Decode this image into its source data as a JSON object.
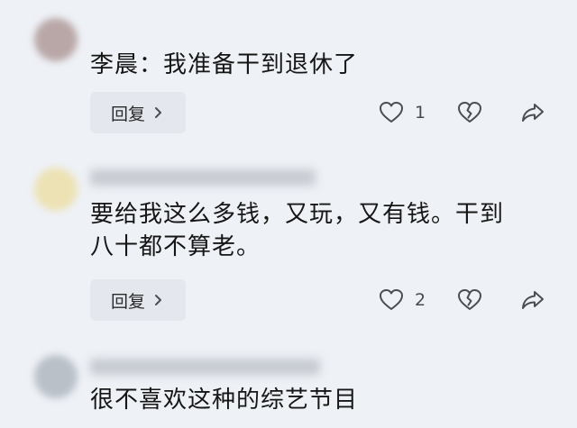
{
  "comments": [
    {
      "text": "李晨：我准备干到退休了",
      "reply_label": "回复",
      "like_count": "1"
    },
    {
      "text": "要给我这么多钱，又玩，又有钱。干到\n八十都不算老。",
      "reply_label": "回复",
      "like_count": "2"
    },
    {
      "text": "很不喜欢这种的综艺节目"
    }
  ],
  "icons": {
    "like": "heart-icon",
    "dislike": "broken-heart-icon",
    "share": "share-icon",
    "reply_chevron": "chevron-right-icon"
  },
  "colors": {
    "background": "#eef1f6",
    "reply_button_bg": "#e4e8ee",
    "icon_stroke": "#4a4d52"
  }
}
